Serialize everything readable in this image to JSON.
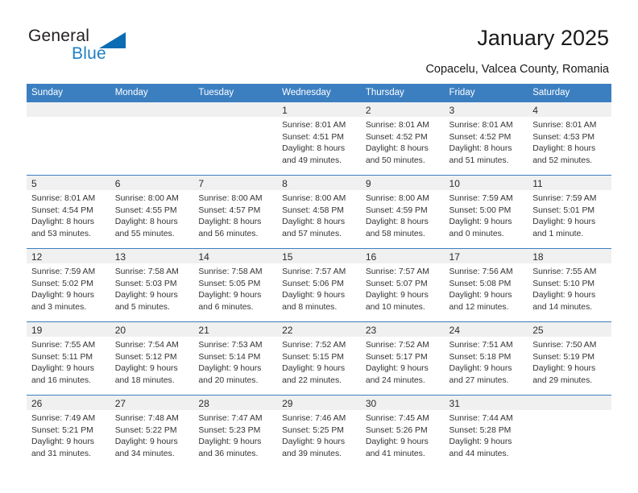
{
  "brand": {
    "name_part1": "General",
    "name_part2": "Blue",
    "logo_icon": "triangle-flag-icon"
  },
  "header": {
    "title": "January 2025",
    "subtitle": "Copacelu, Valcea County, Romania"
  },
  "colors": {
    "header_blue": "#3c7fc1",
    "brand_blue": "#1f7fc4",
    "logo_blue": "#0b6cb3",
    "daynum_band": "#f0f0f0",
    "text": "#333333"
  },
  "calendar": {
    "weekday_headers": [
      "Sunday",
      "Monday",
      "Tuesday",
      "Wednesday",
      "Thursday",
      "Friday",
      "Saturday"
    ],
    "weeks": [
      [
        {
          "day": "",
          "info": ""
        },
        {
          "day": "",
          "info": ""
        },
        {
          "day": "",
          "info": ""
        },
        {
          "day": "1",
          "info": "Sunrise: 8:01 AM\nSunset: 4:51 PM\nDaylight: 8 hours\nand 49 minutes."
        },
        {
          "day": "2",
          "info": "Sunrise: 8:01 AM\nSunset: 4:52 PM\nDaylight: 8 hours\nand 50 minutes."
        },
        {
          "day": "3",
          "info": "Sunrise: 8:01 AM\nSunset: 4:52 PM\nDaylight: 8 hours\nand 51 minutes."
        },
        {
          "day": "4",
          "info": "Sunrise: 8:01 AM\nSunset: 4:53 PM\nDaylight: 8 hours\nand 52 minutes."
        }
      ],
      [
        {
          "day": "5",
          "info": "Sunrise: 8:01 AM\nSunset: 4:54 PM\nDaylight: 8 hours\nand 53 minutes."
        },
        {
          "day": "6",
          "info": "Sunrise: 8:00 AM\nSunset: 4:55 PM\nDaylight: 8 hours\nand 55 minutes."
        },
        {
          "day": "7",
          "info": "Sunrise: 8:00 AM\nSunset: 4:57 PM\nDaylight: 8 hours\nand 56 minutes."
        },
        {
          "day": "8",
          "info": "Sunrise: 8:00 AM\nSunset: 4:58 PM\nDaylight: 8 hours\nand 57 minutes."
        },
        {
          "day": "9",
          "info": "Sunrise: 8:00 AM\nSunset: 4:59 PM\nDaylight: 8 hours\nand 58 minutes."
        },
        {
          "day": "10",
          "info": "Sunrise: 7:59 AM\nSunset: 5:00 PM\nDaylight: 9 hours\nand 0 minutes."
        },
        {
          "day": "11",
          "info": "Sunrise: 7:59 AM\nSunset: 5:01 PM\nDaylight: 9 hours\nand 1 minute."
        }
      ],
      [
        {
          "day": "12",
          "info": "Sunrise: 7:59 AM\nSunset: 5:02 PM\nDaylight: 9 hours\nand 3 minutes."
        },
        {
          "day": "13",
          "info": "Sunrise: 7:58 AM\nSunset: 5:03 PM\nDaylight: 9 hours\nand 5 minutes."
        },
        {
          "day": "14",
          "info": "Sunrise: 7:58 AM\nSunset: 5:05 PM\nDaylight: 9 hours\nand 6 minutes."
        },
        {
          "day": "15",
          "info": "Sunrise: 7:57 AM\nSunset: 5:06 PM\nDaylight: 9 hours\nand 8 minutes."
        },
        {
          "day": "16",
          "info": "Sunrise: 7:57 AM\nSunset: 5:07 PM\nDaylight: 9 hours\nand 10 minutes."
        },
        {
          "day": "17",
          "info": "Sunrise: 7:56 AM\nSunset: 5:08 PM\nDaylight: 9 hours\nand 12 minutes."
        },
        {
          "day": "18",
          "info": "Sunrise: 7:55 AM\nSunset: 5:10 PM\nDaylight: 9 hours\nand 14 minutes."
        }
      ],
      [
        {
          "day": "19",
          "info": "Sunrise: 7:55 AM\nSunset: 5:11 PM\nDaylight: 9 hours\nand 16 minutes."
        },
        {
          "day": "20",
          "info": "Sunrise: 7:54 AM\nSunset: 5:12 PM\nDaylight: 9 hours\nand 18 minutes."
        },
        {
          "day": "21",
          "info": "Sunrise: 7:53 AM\nSunset: 5:14 PM\nDaylight: 9 hours\nand 20 minutes."
        },
        {
          "day": "22",
          "info": "Sunrise: 7:52 AM\nSunset: 5:15 PM\nDaylight: 9 hours\nand 22 minutes."
        },
        {
          "day": "23",
          "info": "Sunrise: 7:52 AM\nSunset: 5:17 PM\nDaylight: 9 hours\nand 24 minutes."
        },
        {
          "day": "24",
          "info": "Sunrise: 7:51 AM\nSunset: 5:18 PM\nDaylight: 9 hours\nand 27 minutes."
        },
        {
          "day": "25",
          "info": "Sunrise: 7:50 AM\nSunset: 5:19 PM\nDaylight: 9 hours\nand 29 minutes."
        }
      ],
      [
        {
          "day": "26",
          "info": "Sunrise: 7:49 AM\nSunset: 5:21 PM\nDaylight: 9 hours\nand 31 minutes."
        },
        {
          "day": "27",
          "info": "Sunrise: 7:48 AM\nSunset: 5:22 PM\nDaylight: 9 hours\nand 34 minutes."
        },
        {
          "day": "28",
          "info": "Sunrise: 7:47 AM\nSunset: 5:23 PM\nDaylight: 9 hours\nand 36 minutes."
        },
        {
          "day": "29",
          "info": "Sunrise: 7:46 AM\nSunset: 5:25 PM\nDaylight: 9 hours\nand 39 minutes."
        },
        {
          "day": "30",
          "info": "Sunrise: 7:45 AM\nSunset: 5:26 PM\nDaylight: 9 hours\nand 41 minutes."
        },
        {
          "day": "31",
          "info": "Sunrise: 7:44 AM\nSunset: 5:28 PM\nDaylight: 9 hours\nand 44 minutes."
        },
        {
          "day": "",
          "info": ""
        }
      ]
    ]
  }
}
